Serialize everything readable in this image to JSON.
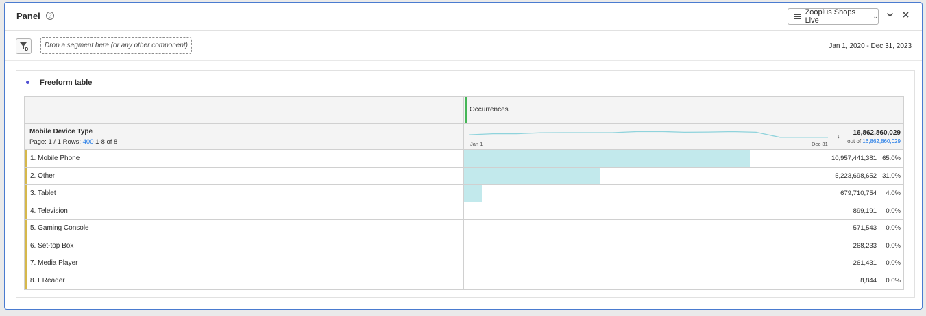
{
  "panel": {
    "title": "Panel",
    "help_icon": "help-circle-icon",
    "report_suite": "Zooplus Shops Live",
    "collapse_icon": "chevron-down-icon",
    "close_icon": "close-icon"
  },
  "toolbar": {
    "filter_icon": "segment-filter-icon",
    "drop_zone": "Drop a segment here (or any other component)",
    "date_range": "Jan 1, 2020 - Dec 31, 2023"
  },
  "freeform": {
    "title": "Freeform table",
    "metric": "Occurrences",
    "dimension": "Mobile Device Type",
    "pager_prefix": "Page: 1 / 1 Rows:",
    "rows_per_page": "400",
    "range": "1-8 of 8",
    "spark_start": "Jan 1",
    "spark_end": "Dec 31",
    "spark_values": [
      0.55,
      0.48,
      0.48,
      0.42,
      0.41,
      0.41,
      0.41,
      0.34,
      0.33,
      0.38,
      0.37,
      0.34,
      0.38,
      0.72,
      0.72,
      0.72
    ],
    "sort_icon": "sort-descending-icon",
    "total": "16,862,860,029",
    "total_prefix": "out of",
    "total_of": "16,862,860,029",
    "rows": [
      {
        "label": "1.  Mobile Phone",
        "value": "10,957,441,381",
        "pct": "65.0%",
        "share": 0.65
      },
      {
        "label": "2.  Other",
        "value": "5,223,698,652",
        "pct": "31.0%",
        "share": 0.31
      },
      {
        "label": "3.  Tablet",
        "value": "679,710,754",
        "pct": "4.0%",
        "share": 0.04
      },
      {
        "label": "4.  Television",
        "value": "899,191",
        "pct": "0.0%",
        "share": 0.0
      },
      {
        "label": "5.  Gaming Console",
        "value": "571,543",
        "pct": "0.0%",
        "share": 0.0
      },
      {
        "label": "6.  Set-top Box",
        "value": "268,233",
        "pct": "0.0%",
        "share": 0.0
      },
      {
        "label": "7.  Media Player",
        "value": "261,431",
        "pct": "0.0%",
        "share": 0.0
      },
      {
        "label": "8.  EReader",
        "value": "8,844",
        "pct": "0.0%",
        "share": 0.0
      }
    ]
  },
  "colors": {
    "accent": "#4a7bd0",
    "bar": "#c2e9ec",
    "metric_marker": "#44b556",
    "row_marker": "#d6b84b",
    "link": "#1473e6"
  }
}
